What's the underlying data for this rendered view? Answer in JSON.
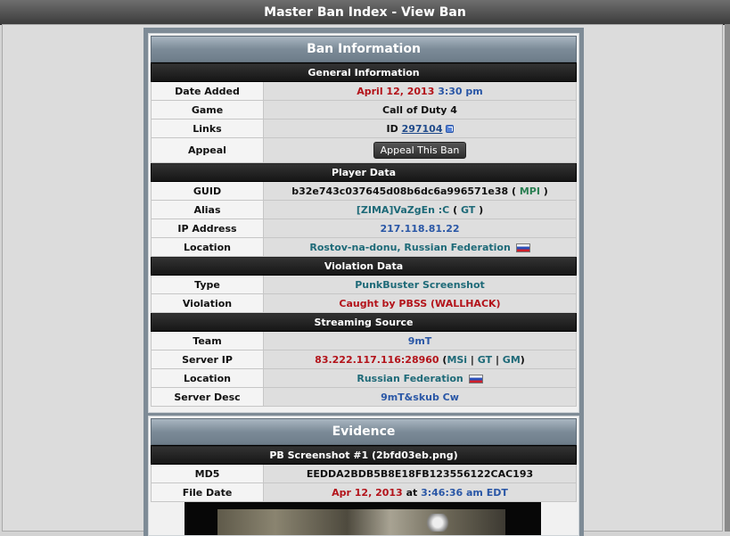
{
  "window": {
    "title": "Master Ban Index - View Ban"
  },
  "ban_panel": {
    "title": "Ban Information",
    "general": {
      "heading": "General Information",
      "date_label": "Date Added",
      "date": "April 12, 2013",
      "time": "3:30 pm",
      "game_label": "Game",
      "game": "Call of Duty 4",
      "links_label": "Links",
      "id_prefix": "ID",
      "id_value": "297104",
      "appeal_label": "Appeal",
      "appeal_button": "Appeal This Ban"
    },
    "player": {
      "heading": "Player Data",
      "guid_label": "GUID",
      "guid": "b32e743c037645d08b6dc6a996571e38",
      "guid_link": "MPI",
      "alias_label": "Alias",
      "alias": "[ZIMA]VaZgEn :C",
      "alias_link": "GT",
      "ip_label": "IP Address",
      "ip": "217.118.81.22",
      "location_label": "Location",
      "location": "Rostov-na-donu, Russian Federation"
    },
    "violation": {
      "heading": "Violation Data",
      "type_label": "Type",
      "type": "PunkBuster Screenshot",
      "violation_label": "Violation",
      "violation": "Caught by PBSS (WALLHACK)"
    },
    "streaming": {
      "heading": "Streaming Source",
      "team_label": "Team",
      "team": "9mT",
      "server_ip_label": "Server IP",
      "server_ip": "83.222.117.116:28960",
      "link_msi": "MSi",
      "link_gt": "GT",
      "link_gm": "GM",
      "location_label": "Location",
      "location": "Russian Federation",
      "desc_label": "Server Desc",
      "desc": "9mT&skub Cw"
    }
  },
  "evidence_panel": {
    "title": "Evidence",
    "screenshot_heading": "PB Screenshot #1 (2bfd03eb.png)",
    "md5_label": "MD5",
    "md5": "EEDDA2BDB5B8E18FB123556122CAC193",
    "file_date_label": "File Date",
    "file_date": "Apr 12, 2013",
    "at_word": "at",
    "file_time": "3:46:36 am EDT"
  },
  "icons": {
    "flag": "russia-flag-icon",
    "external": "external-link-icon"
  },
  "colors": {
    "date_red": "#b3131a",
    "time_blue": "#2a57a6",
    "teal": "#1e6a78",
    "section_dark": "#1d1d1d"
  }
}
